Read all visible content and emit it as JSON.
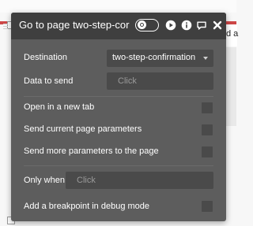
{
  "background": {
    "right_text": "d a"
  },
  "header": {
    "title": "Go to page two-step-cor",
    "icons": [
      "debug-toggle-icon",
      "play-icon",
      "info-icon",
      "comment-icon",
      "close-icon"
    ]
  },
  "form": {
    "destination_label": "Destination",
    "destination_value": "two-step-confirmation",
    "data_to_send_label": "Data to send",
    "data_to_send_placeholder": "Click",
    "open_new_tab_label": "Open in a new tab",
    "send_params_label": "Send current page parameters",
    "send_more_params_label": "Send more parameters to the page",
    "only_when_label": "Only when",
    "only_when_placeholder": "Click",
    "breakpoint_label": "Add a breakpoint in debug mode"
  },
  "colors": {
    "panel_bg": "#5d5d5d",
    "header_bg": "#3f3f3f",
    "field_bg": "#4a4a4a",
    "text": "#ffffff",
    "placeholder": "#9a9a9a",
    "accent_red": "#c62828"
  }
}
